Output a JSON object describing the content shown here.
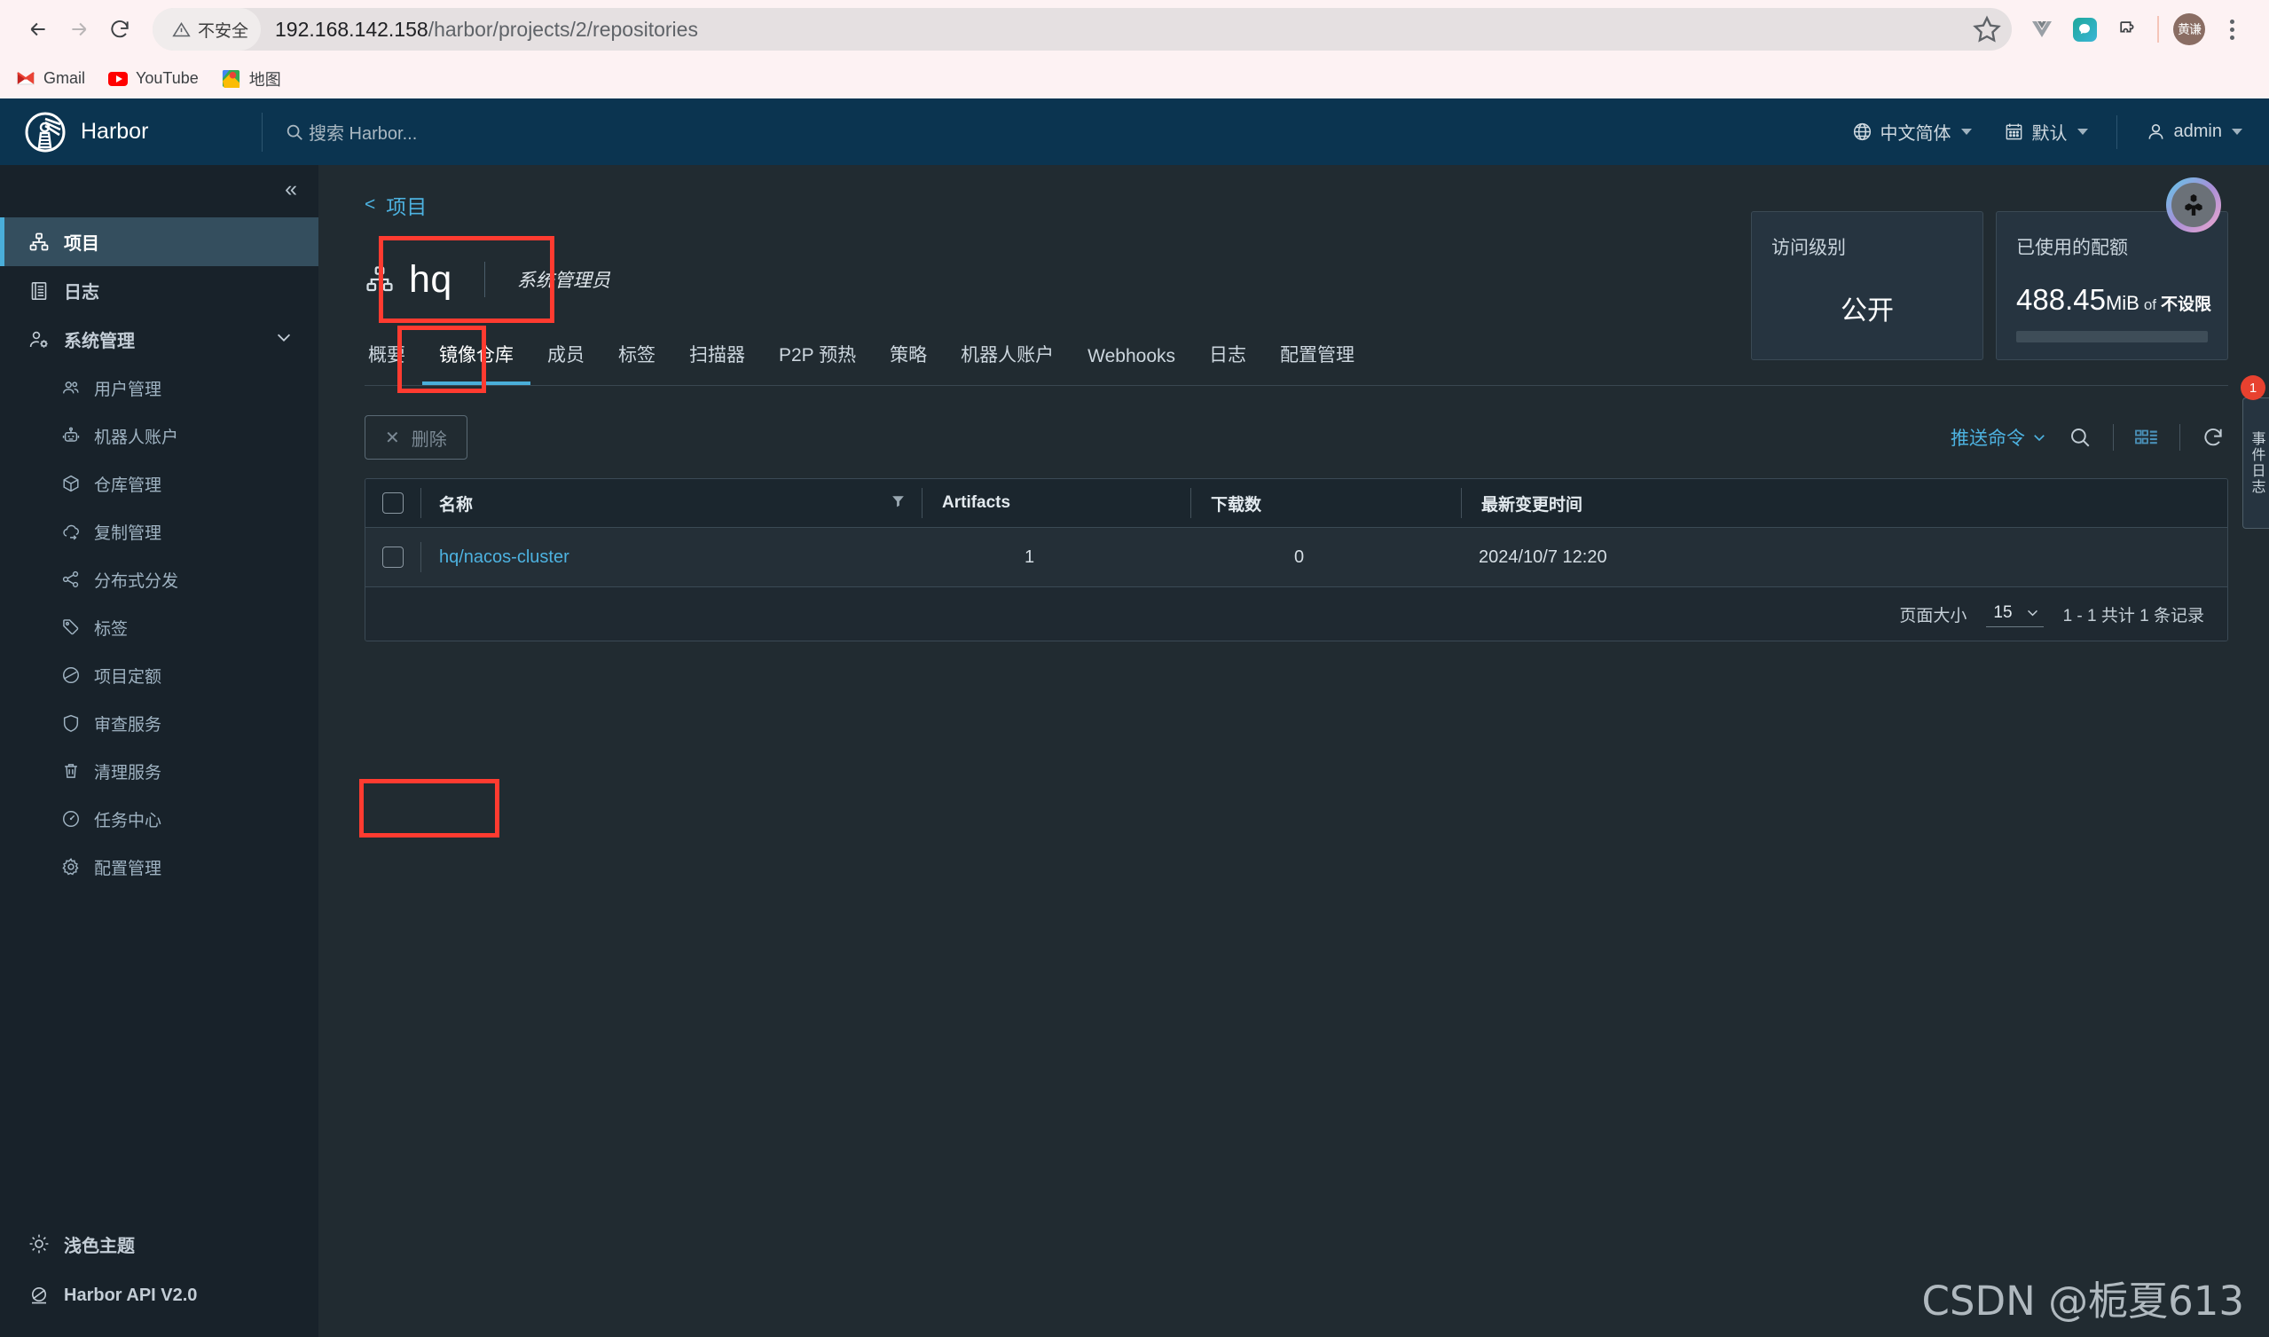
{
  "browser": {
    "back_icon": "back-arrow-icon",
    "forward_icon": "forward-arrow-icon",
    "reload_icon": "reload-icon",
    "security_label": "不安全",
    "url_host": "192.168.142.158",
    "url_path": "/harbor/projects/2/repositories",
    "bookmarks": [
      {
        "label": "Gmail",
        "icon": "gmail-icon"
      },
      {
        "label": "YouTube",
        "icon": "youtube-icon"
      },
      {
        "label": "地图",
        "icon": "maps-icon"
      }
    ],
    "actions": [
      {
        "name": "vue-devtools-icon"
      },
      {
        "name": "chat-extension-icon"
      },
      {
        "name": "extensions-puzzle-icon"
      }
    ],
    "profile_initials": "黄谦",
    "menu_icon": "kebab-menu-icon"
  },
  "header": {
    "brand": "Harbor",
    "search_placeholder": "搜索 Harbor...",
    "language": "中文简体",
    "theme_preset": "默认",
    "user": "admin"
  },
  "sidebar": {
    "collapse_icon": "collapse-chevrons-icon",
    "items": [
      {
        "label": "项目",
        "icon": "projects-icon",
        "active": true
      },
      {
        "label": "日志",
        "icon": "logs-icon",
        "active": false
      },
      {
        "label": "系统管理",
        "icon": "administration-icon",
        "active": false,
        "expandable": true
      }
    ],
    "sub_items": [
      {
        "label": "用户管理",
        "icon": "users-icon"
      },
      {
        "label": "机器人账户",
        "icon": "robot-icon"
      },
      {
        "label": "仓库管理",
        "icon": "registry-icon"
      },
      {
        "label": "复制管理",
        "icon": "replication-icon"
      },
      {
        "label": "分布式分发",
        "icon": "distribution-icon"
      },
      {
        "label": "标签",
        "icon": "label-tag-icon"
      },
      {
        "label": "项目定额",
        "icon": "quota-pie-icon"
      },
      {
        "label": "审查服务",
        "icon": "shield-icon"
      },
      {
        "label": "清理服务",
        "icon": "trash-icon"
      },
      {
        "label": "任务中心",
        "icon": "dashboard-gauge-icon"
      },
      {
        "label": "配置管理",
        "icon": "gear-icon"
      }
    ],
    "footer": [
      {
        "label": "浅色主题",
        "icon": "sun-icon"
      },
      {
        "label": "Harbor API V2.0",
        "icon": "api-icon"
      }
    ]
  },
  "main": {
    "breadcrumb": "项目",
    "project_name": "hq",
    "project_role": "系统管理员",
    "tabs": [
      {
        "label": "概要",
        "active": false
      },
      {
        "label": "镜像仓库",
        "active": true
      },
      {
        "label": "成员",
        "active": false
      },
      {
        "label": "标签",
        "active": false
      },
      {
        "label": "扫描器",
        "active": false
      },
      {
        "label": "P2P 预热",
        "active": false
      },
      {
        "label": "策略",
        "active": false
      },
      {
        "label": "机器人账户",
        "active": false
      },
      {
        "label": "Webhooks",
        "active": false
      },
      {
        "label": "日志",
        "active": false
      },
      {
        "label": "配置管理",
        "active": false
      }
    ],
    "cards": {
      "access_title": "访问级别",
      "access_value": "公开",
      "quota_title": "已使用的配额",
      "quota_used": "488.45",
      "quota_unit": "MiB",
      "quota_of": "of",
      "quota_limit": "不设限"
    },
    "event_log_tab": "事件日志",
    "event_log_badge": "1",
    "toolbar": {
      "delete_label": "删除",
      "delete_icon": "close-x-icon",
      "push_command": "推送命令",
      "search_icon": "search-icon",
      "view_toggle_icon": "grid-list-toggle-icon",
      "refresh_icon": "refresh-icon"
    },
    "table": {
      "columns": [
        "名称",
        "Artifacts",
        "下载数",
        "最新变更时间"
      ],
      "filter_icon": "filter-funnel-icon",
      "rows": [
        {
          "name": "hq/nacos-cluster",
          "artifacts": "1",
          "downloads": "0",
          "updated": "2024/10/7 12:20"
        }
      ]
    },
    "pagination": {
      "page_size_label": "页面大小",
      "page_size_value": "15",
      "total_label": "1 - 1 共计 1 条记录"
    },
    "watermark": "CSDN @栀夏613"
  },
  "colors": {
    "accent_blue": "#4db2e0",
    "header_navy": "#0b3450",
    "sidebar_bg": "#18222a",
    "content_bg": "#212b31",
    "annotation_red": "#ff3b30",
    "badge_red": "#e8412f"
  }
}
